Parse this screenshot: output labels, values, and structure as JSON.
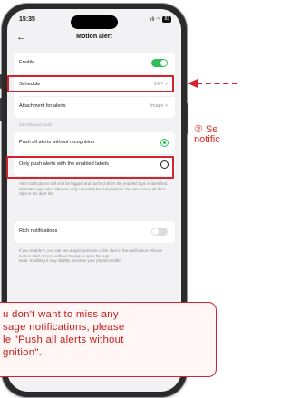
{
  "status": {
    "time": "15:35",
    "signal": "ıll",
    "wifi": "◠",
    "battery": "83"
  },
  "nav": {
    "title": "Motion alert",
    "back_icon": "←"
  },
  "rows": {
    "enable": {
      "label": "Enable",
      "toggle": "on"
    },
    "schedule": {
      "label": "Schedule",
      "value": "24/7 >"
    },
    "attachment": {
      "label": "Attachment for alerts",
      "value": "Image >"
    }
  },
  "identify": {
    "section_label": "Identify and push",
    "push_all": {
      "label": "Push all alerts without recognition",
      "selected": true
    },
    "push_enabled": {
      "label": "Only push alerts with the enabled labels",
      "selected": false
    },
    "note": "Alert notifications will only be lagged and pushed when the enabled type is identified. Mismatch type alert clips are only recorded but not pushed. You can review all alert clips in the alert list."
  },
  "rich": {
    "label": "Rich notifications",
    "toggle": "off",
    "note": "If you enable it, you can see a quick preview of the alert in the notification when a motion alert occurs, without having to open the App.\nNote: Enabling it may slightly increase your phone's traffic."
  },
  "annotation": {
    "step_text": "② Se\nnotific",
    "callout_text": "u don't want to miss any\nsage notifications, please\nle \"Push all alerts without\ngnition\"."
  },
  "colors": {
    "accent_green": "#2fbf5a",
    "highlight_red": "#d1242f",
    "toggle_off": "#dcdcdc"
  }
}
